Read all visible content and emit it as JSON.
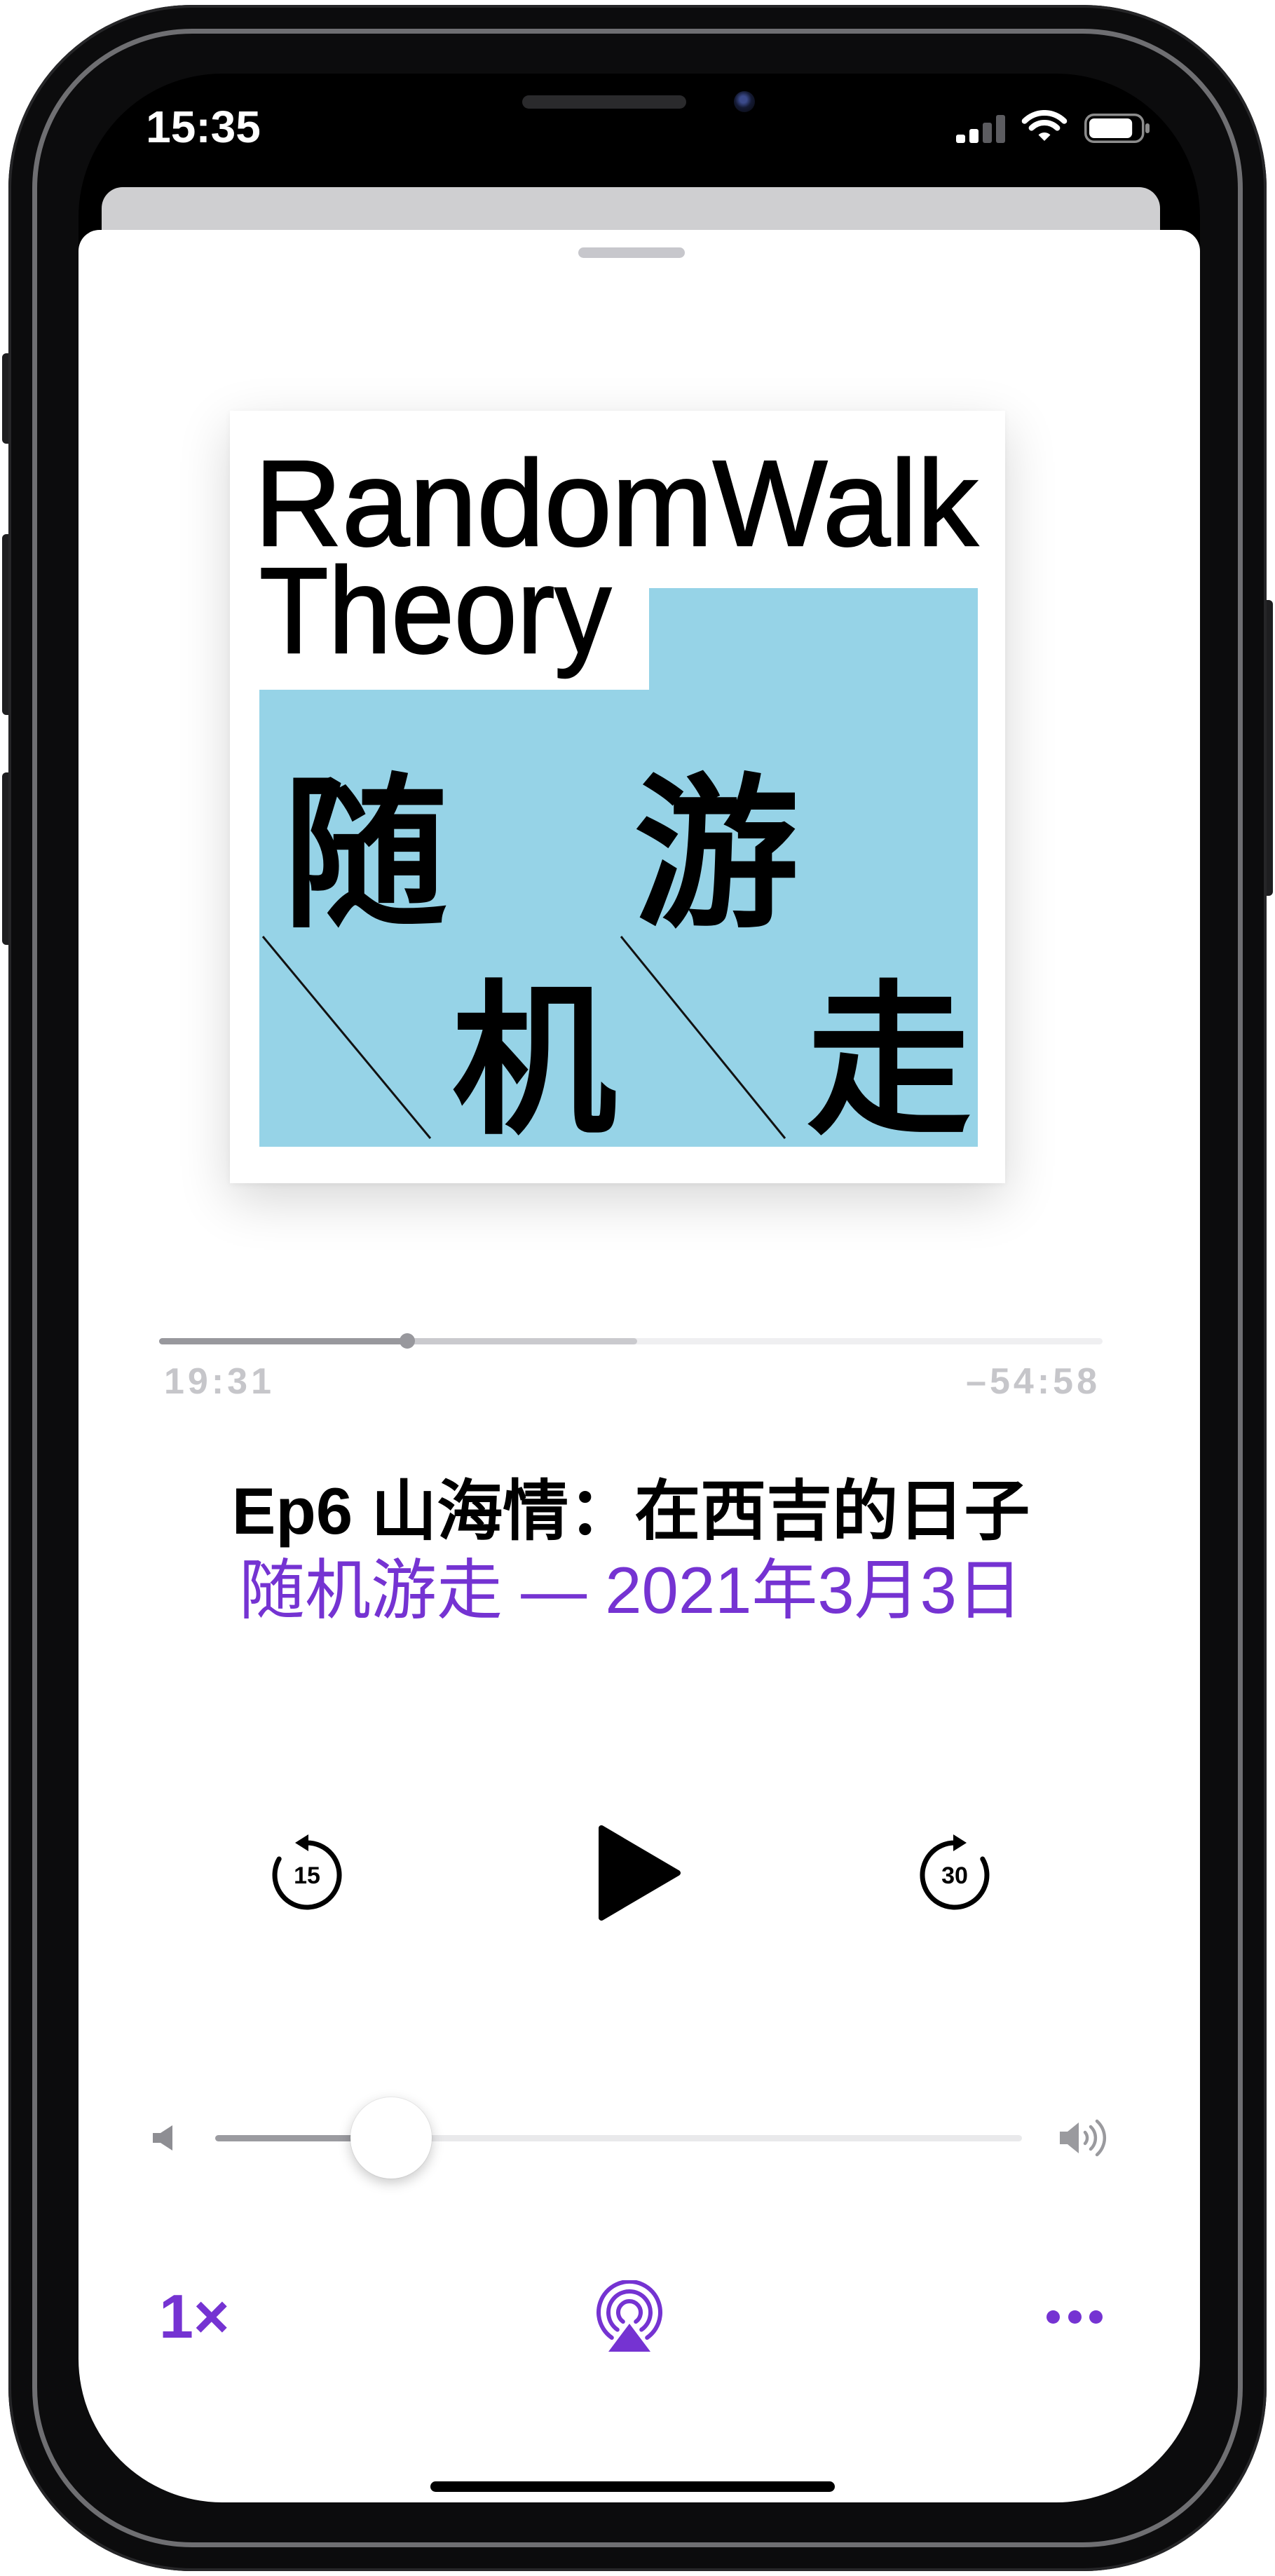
{
  "status_bar": {
    "time": "15:35",
    "signal_icon": "cellular-signal-icon",
    "signal_bars_active": 2,
    "wifi_icon": "wifi-icon",
    "battery_icon": "battery-icon",
    "battery_level": 0.85
  },
  "sheet": {
    "grabber_icon": "grabber-handle-icon"
  },
  "artwork": {
    "title_line_1": "RandomWalk",
    "title_line_2": "Theory",
    "characters": [
      "随",
      "游",
      "机",
      "走"
    ]
  },
  "progress": {
    "elapsed": "19:31",
    "remaining": "–54:58",
    "played_fraction": 0.263,
    "buffered_fraction": 0.507
  },
  "episode": {
    "title": "Ep6 山海情：在西吉的日子",
    "subtitle": "随机游走 — 2021年3月3日"
  },
  "controls": {
    "skip_back_icon": "skip-back-15-icon",
    "skip_back_seconds": "15",
    "play_icon": "play-icon",
    "skip_forward_icon": "skip-forward-30-icon",
    "skip_forward_seconds": "30"
  },
  "volume": {
    "level": 0.218,
    "min_icon": "speaker-low-icon",
    "max_icon": "speaker-high-icon"
  },
  "bottom_bar": {
    "speed_label": "1×",
    "airplay_icon": "airplay-audio-icon",
    "more_icon": "more-icon"
  },
  "colors": {
    "accent": "#7533d2",
    "artwork_blue": "#96d3e7"
  }
}
